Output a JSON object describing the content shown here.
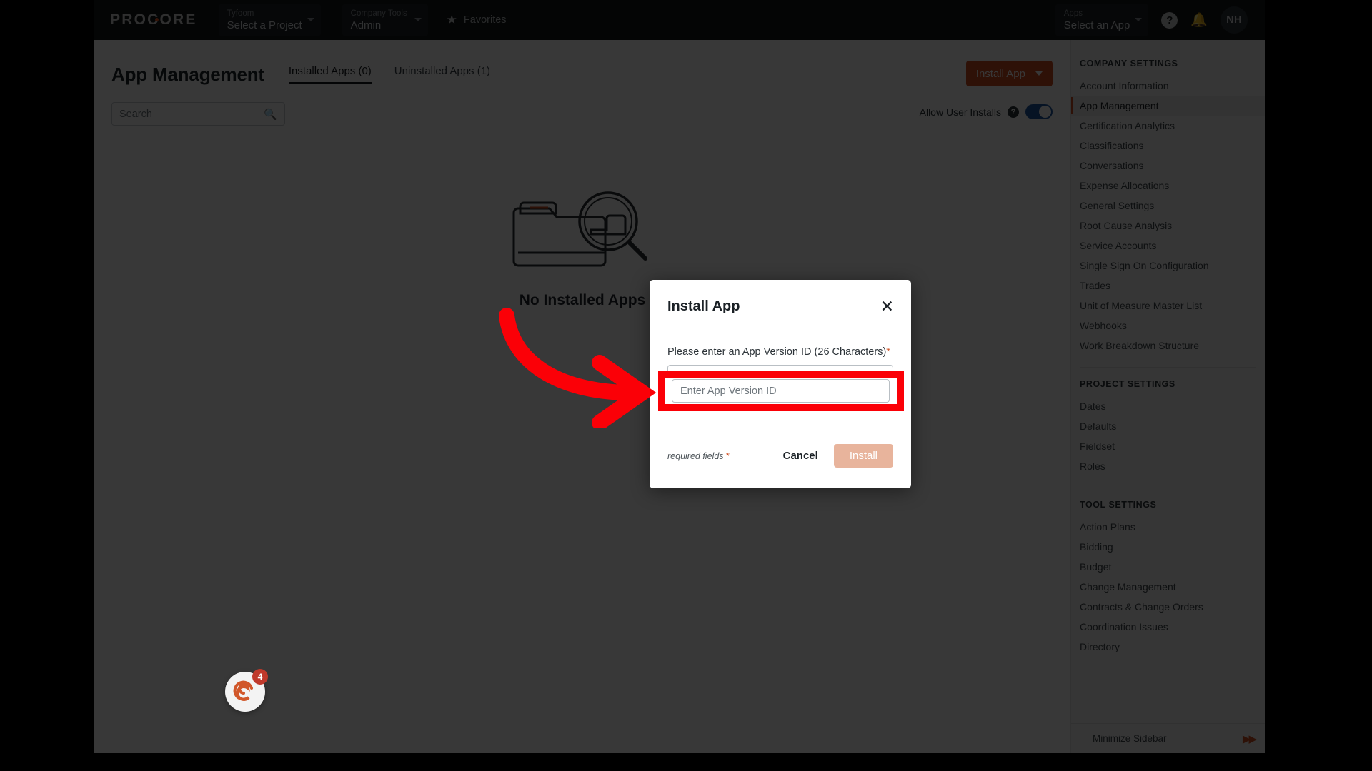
{
  "topnav": {
    "logo": "PROCORE",
    "project_selector": {
      "label": "Tyfoom",
      "value": "Select a Project"
    },
    "tools_selector": {
      "label": "Company Tools",
      "value": "Admin"
    },
    "favorites_label": "Favorites",
    "apps_selector": {
      "label": "Apps",
      "value": "Select an App"
    },
    "help_icon": "help-circle-icon",
    "notifications_icon": "bell-icon",
    "avatar_initials": "NH"
  },
  "page": {
    "title": "App Management",
    "tabs": [
      {
        "label": "Installed Apps (0)",
        "active": true
      },
      {
        "label": "Uninstalled Apps (1)",
        "active": false
      }
    ],
    "install_button": "Install App",
    "search_placeholder": "Search",
    "allow_user_installs_label": "Allow User Installs",
    "allow_user_installs_toggle": "on",
    "help_glyph": "?",
    "empty_state": {
      "title": "No Installed Apps",
      "subtitle": "",
      "illustration": "folder-magnifier-icon"
    }
  },
  "sidebar": {
    "sections": [
      {
        "header": "COMPANY SETTINGS",
        "items": [
          {
            "label": "Account Information",
            "active": false
          },
          {
            "label": "App Management",
            "active": true
          },
          {
            "label": "Certification Analytics",
            "active": false
          },
          {
            "label": "Classifications",
            "active": false
          },
          {
            "label": "Conversations",
            "active": false
          },
          {
            "label": "Expense Allocations",
            "active": false
          },
          {
            "label": "General Settings",
            "active": false
          },
          {
            "label": "Root Cause Analysis",
            "active": false
          },
          {
            "label": "Service Accounts",
            "active": false
          },
          {
            "label": "Single Sign On Configuration",
            "active": false
          },
          {
            "label": "Trades",
            "active": false
          },
          {
            "label": "Unit of Measure Master List",
            "active": false
          },
          {
            "label": "Webhooks",
            "active": false
          },
          {
            "label": "Work Breakdown Structure",
            "active": false
          }
        ]
      },
      {
        "header": "PROJECT SETTINGS",
        "items": [
          {
            "label": "Dates",
            "active": false
          },
          {
            "label": "Defaults",
            "active": false
          },
          {
            "label": "Fieldset",
            "active": false
          },
          {
            "label": "Roles",
            "active": false
          }
        ]
      },
      {
        "header": "TOOL SETTINGS",
        "items": [
          {
            "label": "Action Plans",
            "active": false
          },
          {
            "label": "Bidding",
            "active": false
          },
          {
            "label": "Budget",
            "active": false
          },
          {
            "label": "Change Management",
            "active": false
          },
          {
            "label": "Contracts & Change Orders",
            "active": false
          },
          {
            "label": "Coordination Issues",
            "active": false
          },
          {
            "label": "Directory",
            "active": false
          }
        ]
      }
    ],
    "minimize_label": "Minimize Sidebar",
    "minimize_icon": "double-chevron-right-icon"
  },
  "chat_widget": {
    "icon": "spiral-chat-icon",
    "badge": "4"
  },
  "modal": {
    "title": "Install App",
    "close_icon": "close-icon",
    "field_label": "Please enter an App Version ID (26 Characters)",
    "field_required_marker": "*",
    "field_placeholder": "Enter App Version ID",
    "field_value": "",
    "required_note": "required fields",
    "required_note_star": "*",
    "cancel_label": "Cancel",
    "install_label": "Install"
  },
  "annotation": {
    "highlight_color": "#fb0007",
    "arrow_color": "#fb0007",
    "target": "app-version-id-input"
  },
  "colors": {
    "brand_orange": "#d14e20",
    "topnav_bg": "#13171a",
    "sidebar_bg": "#f4f4f4",
    "toggle_on": "#1d57a3"
  }
}
